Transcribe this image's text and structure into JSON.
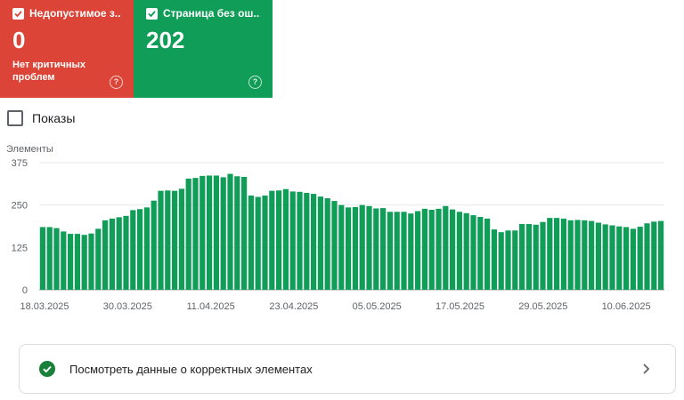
{
  "cards": [
    {
      "label": "Недопустимое з...",
      "value": "0",
      "subtitle": "Нет критичных проблем",
      "color": "#db4437"
    },
    {
      "label": "Страница без ош...",
      "value": "202",
      "subtitle": "",
      "color": "#0f9d58"
    }
  ],
  "help_icon": "?",
  "toggle": {
    "label": "Показы",
    "checked": false
  },
  "chart_data": {
    "type": "bar",
    "ylabel": "Элементы",
    "ylim": [
      0,
      375
    ],
    "yticks": [
      0,
      125,
      250,
      375
    ],
    "xticks": [
      "18.03.2025",
      "30.03.2025",
      "11.04.2025",
      "23.04.2025",
      "05.05.2025",
      "17.05.2025",
      "29.05.2025",
      "10.06.2025"
    ],
    "bar_color": "#0f9d58",
    "values": [
      185,
      185,
      182,
      172,
      165,
      165,
      162,
      166,
      180,
      205,
      210,
      214,
      218,
      235,
      238,
      243,
      263,
      292,
      293,
      292,
      298,
      328,
      330,
      336,
      337,
      337,
      332,
      342,
      335,
      333,
      278,
      274,
      278,
      292,
      293,
      297,
      290,
      289,
      286,
      283,
      275,
      270,
      262,
      250,
      243,
      244,
      250,
      247,
      240,
      241,
      230,
      230,
      230,
      225,
      232,
      239,
      236,
      239,
      247,
      237,
      230,
      226,
      220,
      215,
      210,
      178,
      170,
      175,
      175,
      194,
      194,
      192,
      200,
      212,
      212,
      210,
      205,
      206,
      205,
      203,
      198,
      193,
      190,
      187,
      185,
      180,
      186,
      196,
      201,
      203
    ]
  },
  "footer": {
    "label": "Посмотреть данные о корректных элементах"
  }
}
